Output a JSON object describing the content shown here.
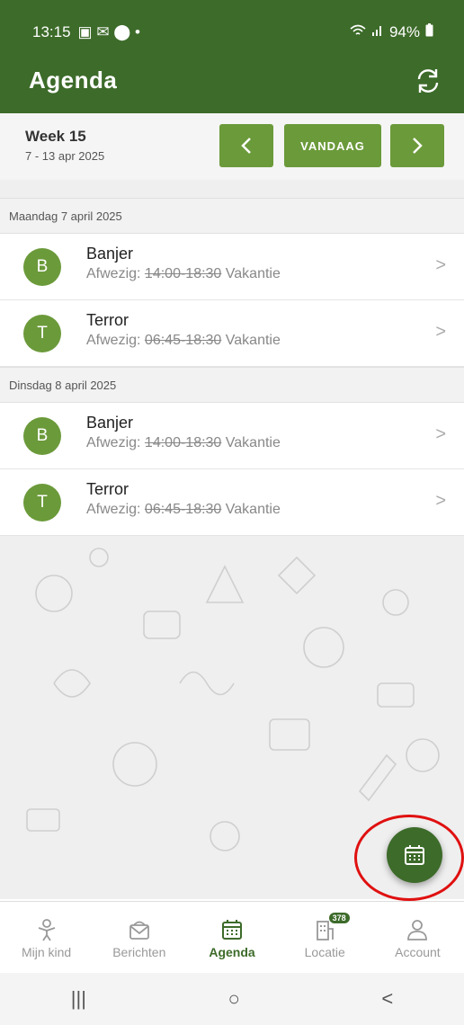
{
  "status": {
    "time": "13:15",
    "icons": "▣ ✉ ⬤ •",
    "battery": "94%"
  },
  "appbar": {
    "title": "Agenda"
  },
  "week": {
    "label": "Week 15",
    "range": "7 - 13 apr 2025",
    "prev": "<",
    "today": "VANDAAG",
    "next": ">"
  },
  "days": [
    {
      "header": "Maandag 7 april 2025",
      "items": [
        {
          "initial": "B",
          "name": "Banjer",
          "prefix": "Afwezig:",
          "time": "14:00-18:30",
          "reason": "Vakantie"
        },
        {
          "initial": "T",
          "name": "Terror",
          "prefix": "Afwezig:",
          "time": "06:45-18:30",
          "reason": "Vakantie"
        }
      ]
    },
    {
      "header": "Dinsdag 8 april 2025",
      "items": [
        {
          "initial": "B",
          "name": "Banjer",
          "prefix": "Afwezig:",
          "time": "14:00-18:30",
          "reason": "Vakantie"
        },
        {
          "initial": "T",
          "name": "Terror",
          "prefix": "Afwezig:",
          "time": "06:45-18:30",
          "reason": "Vakantie"
        }
      ]
    }
  ],
  "nav": {
    "mijn_kind": "Mijn kind",
    "berichten": "Berichten",
    "agenda": "Agenda",
    "locatie": "Locatie",
    "locatie_badge": "378",
    "account": "Account"
  },
  "sysnav": {
    "recent": "|||",
    "home": "○",
    "back": "<"
  },
  "colors": {
    "primary": "#3d6b2a",
    "accent": "#6b9a3a",
    "highlight": "#e01010"
  }
}
